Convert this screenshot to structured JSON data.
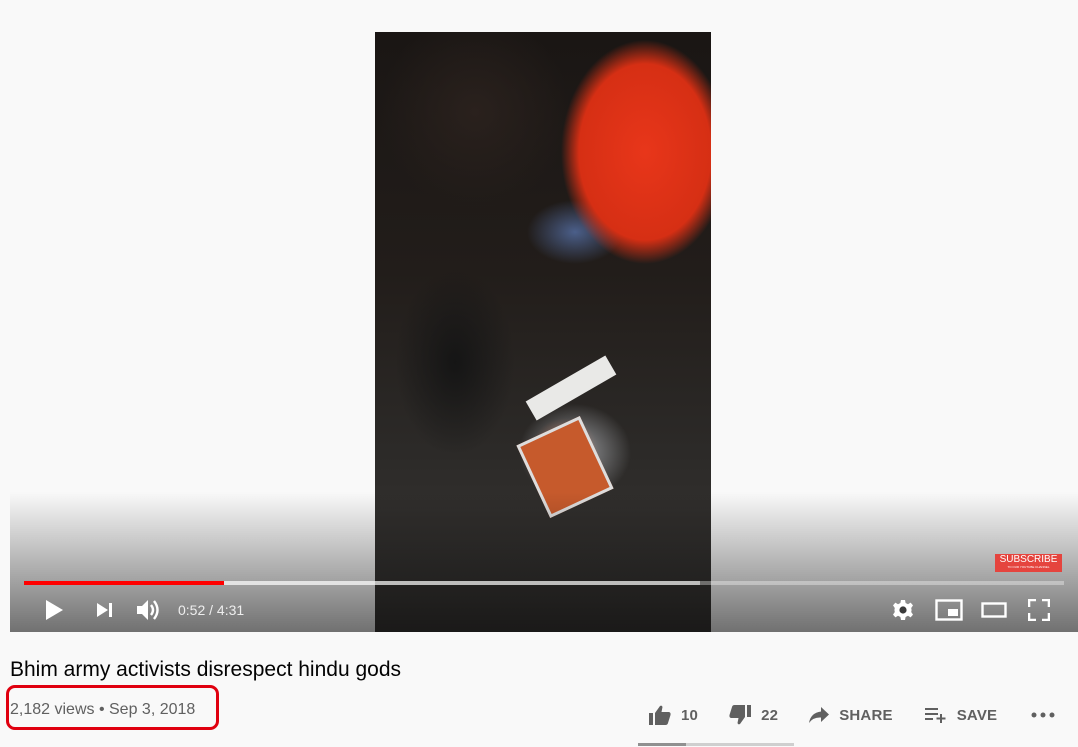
{
  "player": {
    "subscribe_badge": "SUBSCRIBE",
    "subscribe_small": "TO OUR YOUTUBE CHANNEL",
    "current_time": "0:52",
    "duration": "4:31",
    "time_separator": " / ",
    "played_fraction": 0.192,
    "buffered_fraction": 0.65,
    "icons": [
      "play-icon",
      "next-icon",
      "volume-icon",
      "settings-icon",
      "miniplayer-icon",
      "theater-icon",
      "fullscreen-icon"
    ]
  },
  "video": {
    "title": "Bhim army activists disrespect hindu gods",
    "views": "2,182 views",
    "separator": " • ",
    "date": "Sep 3, 2018"
  },
  "actions": {
    "likes": "10",
    "dislikes": "22",
    "share_label": "SHARE",
    "save_label": "SAVE",
    "like_ratio": 0.31
  },
  "colors": {
    "accent": "#ff0000",
    "highlight": "#e0000f"
  }
}
